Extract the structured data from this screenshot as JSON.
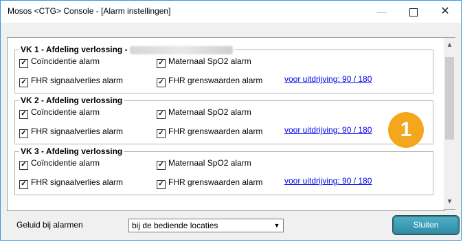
{
  "window": {
    "title": "Mosos <CTG> Console - [Alarm instellingen]",
    "minimize": "—",
    "close": "✕"
  },
  "groups": [
    {
      "title": "VK 1 - Afdeling verlossing -",
      "coincidentie": "Coïncidentie alarm",
      "maternaal": "Maternaal SpO2 alarm",
      "fhr_signaal": "FHR signaalverlies alarm",
      "fhr_grens": "FHR grenswaarden alarm",
      "link": "voor uitdrijving: 90 / 180",
      "checked": [
        true,
        true,
        true,
        true
      ]
    },
    {
      "title": "VK 2 - Afdeling verlossing",
      "coincidentie": "Coïncidentie alarm",
      "maternaal": "Maternaal SpO2 alarm",
      "fhr_signaal": "FHR signaalverlies alarm",
      "fhr_grens": "FHR grenswaarden alarm",
      "link": "voor uitdrijving: 90 / 180",
      "checked": [
        true,
        true,
        true,
        true
      ]
    },
    {
      "title": "VK 3 - Afdeling verlossing",
      "coincidentie": "Coïncidentie alarm",
      "maternaal": "Maternaal SpO2 alarm",
      "fhr_signaal": "FHR signaalverlies alarm",
      "fhr_grens": "FHR grenswaarden alarm",
      "link": "voor uitdrijving: 90 / 180",
      "checked": [
        true,
        true,
        true,
        true
      ]
    }
  ],
  "badge": "1",
  "footer": {
    "label": "Geluid bij alarmen",
    "select_value": "bij de bediende locaties",
    "close_button": "Sluiten"
  },
  "colors": {
    "badge": "#f4a71d",
    "link": "#0000ee",
    "window_border": "#3a96dd"
  }
}
